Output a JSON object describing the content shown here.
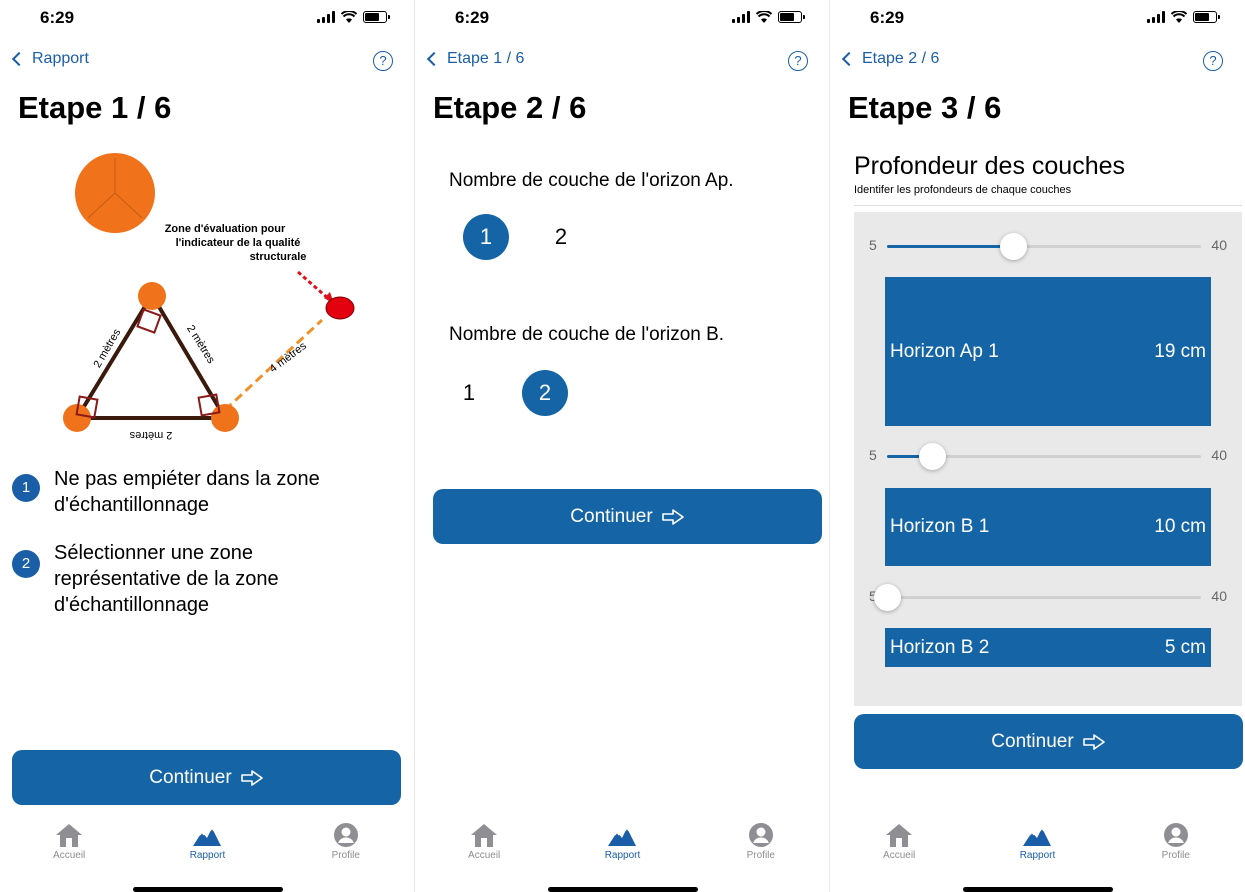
{
  "status": {
    "time": "6:29"
  },
  "colors": {
    "primary": "#1565a6",
    "link": "#1a5ea8",
    "inactive": "#8e8e93"
  },
  "screen1": {
    "back_label": "Rapport",
    "title": "Etape 1 / 6",
    "diagram": {
      "zone_title_lines": [
        "Zone d'évaluation pour",
        "l'indicateur de la qualité",
        "structurale"
      ],
      "side_left": "2 mètres",
      "side_right": "2 mètres",
      "side_bottom": "2 mètres",
      "distance_label": "4 mètres"
    },
    "steps": [
      {
        "number": "1",
        "text": "Ne pas empiéter dans la zone d'échantillonnage"
      },
      {
        "number": "2",
        "text": "Sélectionner une zone représentative de la zone d'échantillonnage"
      }
    ],
    "continue_label": "Continuer"
  },
  "screen2": {
    "back_label": "Etape 1 / 6",
    "title": "Etape 2 / 6",
    "question_ap": "Nombre de couche de l'orizon Ap.",
    "question_b": "Nombre de couche de l'orizon B.",
    "ap_options": [
      "1",
      "2"
    ],
    "ap_selected": "1",
    "b_options": [
      "1",
      "2"
    ],
    "b_selected": "2",
    "continue_label": "Continuer"
  },
  "screen3": {
    "back_label": "Etape 2 / 6",
    "title": "Etape 3 / 6",
    "section_title": "Profondeur des couches",
    "section_subtitle": "Identifer les profondeurs de chaque couches",
    "sliders": [
      {
        "min": "5",
        "max": "40",
        "value": 19
      },
      {
        "min": "5",
        "max": "40",
        "value": 10
      },
      {
        "min": "5",
        "max": "40",
        "value": 5
      }
    ],
    "horizons": [
      {
        "name": "Horizon Ap 1",
        "depth": "19 cm"
      },
      {
        "name": "Horizon B 1",
        "depth": "10 cm"
      },
      {
        "name": "Horizon B 2",
        "depth": "5 cm"
      }
    ],
    "continue_label": "Continuer"
  },
  "tabbar": {
    "tabs": [
      {
        "label": "Accueil",
        "icon": "home-icon"
      },
      {
        "label": "Rapport",
        "icon": "mountains-icon"
      },
      {
        "label": "Profile",
        "icon": "user-icon"
      }
    ],
    "active": "Rapport"
  }
}
